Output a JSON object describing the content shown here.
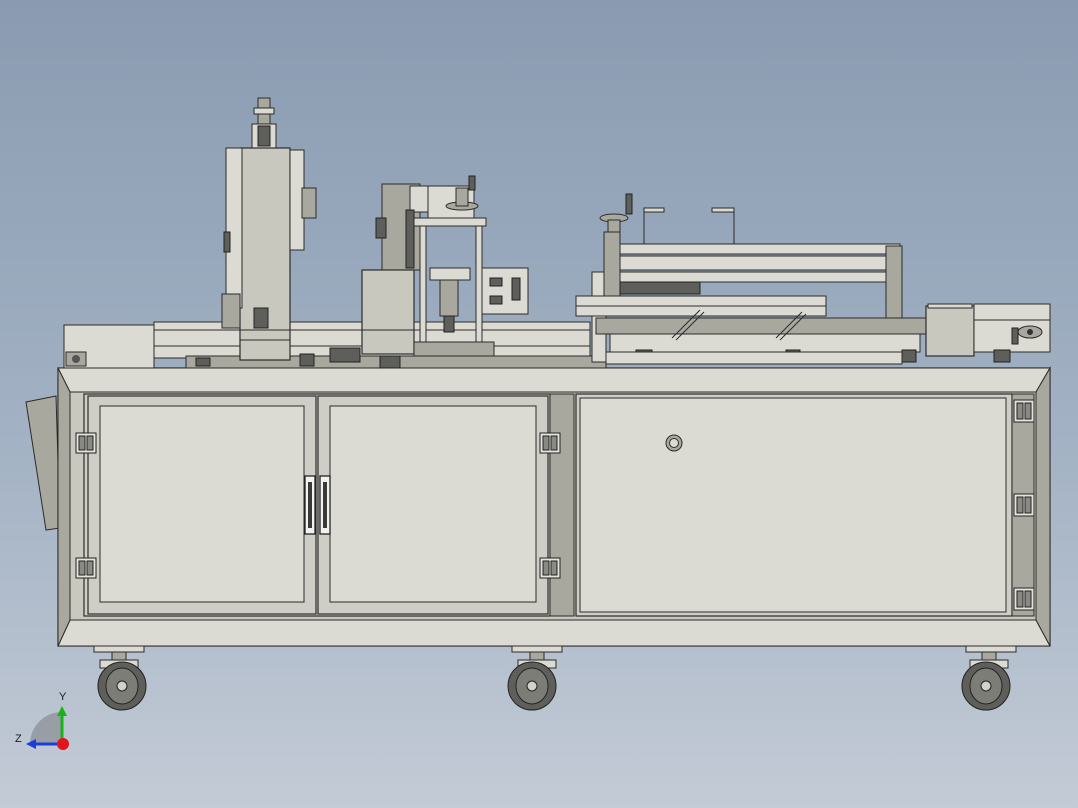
{
  "triad": {
    "y_label": "Y",
    "z_label": "Z"
  },
  "colors": {
    "background_top": "#8a9bb1",
    "background_bottom": "#c3cbd6",
    "machine_body": "#c9c8bf",
    "axis_y": "#19b319",
    "axis_z": "#1b3fd6",
    "axis_x_origin": "#e3141b"
  }
}
